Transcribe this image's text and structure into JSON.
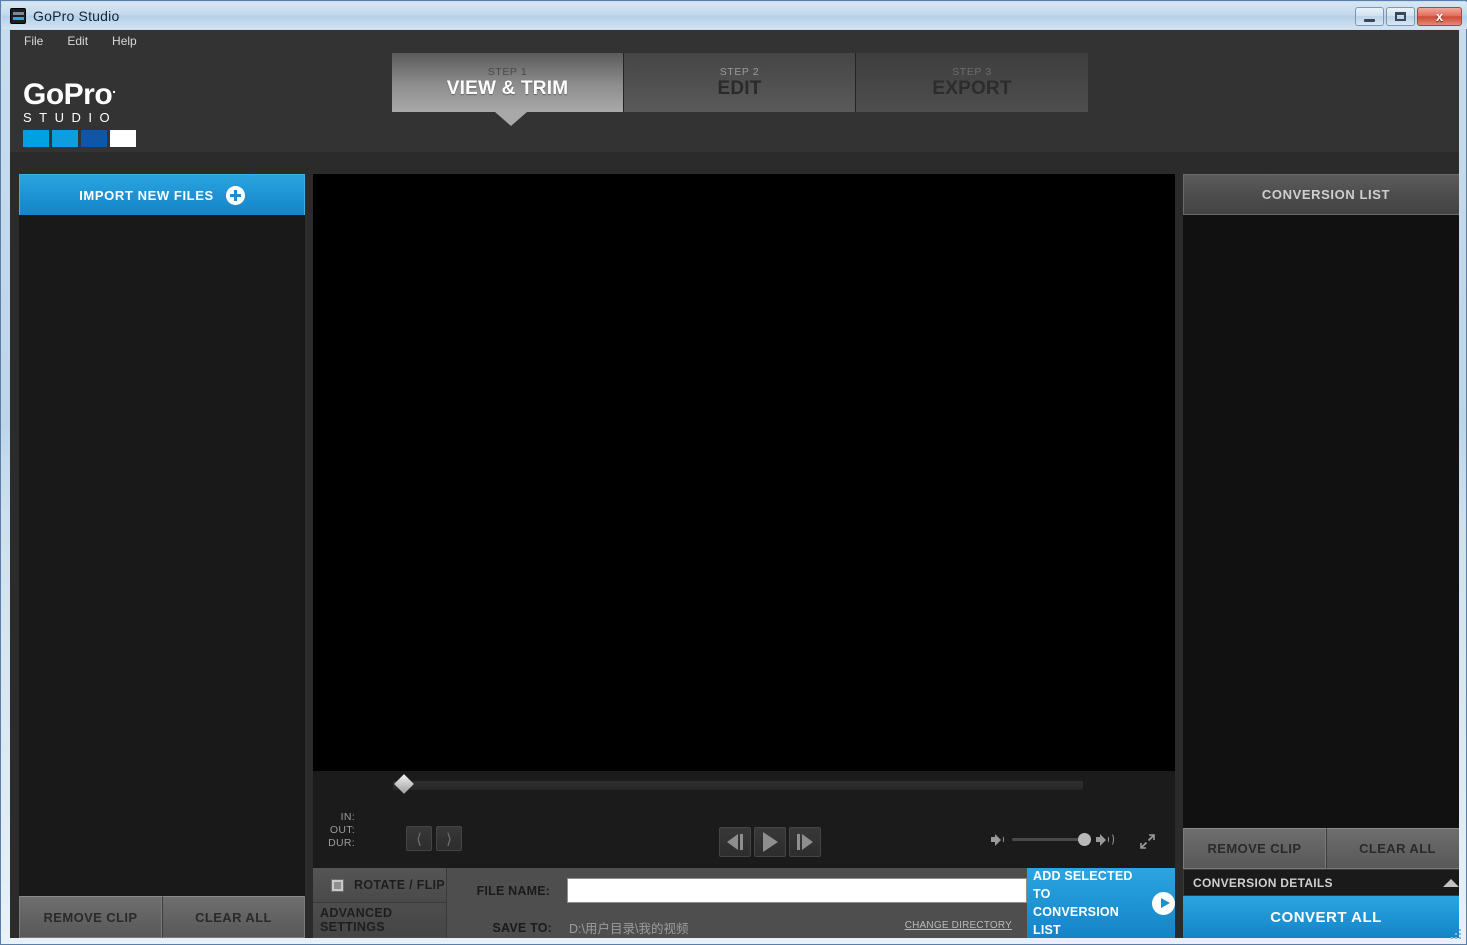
{
  "window": {
    "title": "GoPro Studio",
    "minimize_label": "Minimize",
    "maximize_label": "Maximize",
    "close_label": "x"
  },
  "menu": [
    {
      "label": "File"
    },
    {
      "label": "Edit"
    },
    {
      "label": "Help"
    }
  ],
  "logo": {
    "brand": "GoPro",
    "brand_mark": ".",
    "product": "STUDIO",
    "swatches": [
      "#00a1e0",
      "#0e9ee0",
      "#0d57a6",
      "#ffffff"
    ]
  },
  "steps": [
    {
      "num": "STEP 1",
      "name": "VIEW & TRIM",
      "active": true
    },
    {
      "num": "STEP 2",
      "name": "EDIT",
      "active": false
    },
    {
      "num": "STEP 3",
      "name": "EXPORT",
      "active": false
    }
  ],
  "left_panel": {
    "import_label": "IMPORT NEW FILES",
    "remove_clip_label": "REMOVE CLIP",
    "clear_all_label": "CLEAR ALL",
    "clips": []
  },
  "player": {
    "in_label": "IN:",
    "out_label": "OUT:",
    "dur_label": "DUR:",
    "in_value": "",
    "out_value": "",
    "dur_value": "",
    "set_in_label": "Set In Point",
    "set_out_label": "Set Out Point",
    "prev_frame_label": "Previous Frame",
    "play_label": "Play",
    "next_frame_label": "Next Frame",
    "volume_percent": 100,
    "fullscreen_label": "Fullscreen",
    "playhead_position_percent": 0
  },
  "settings": {
    "rotate_flip_label": "ROTATE / FLIP",
    "rotate_flip_checked": false,
    "advanced_settings_label": "ADVANCED SETTINGS",
    "file_name_label": "FILE NAME:",
    "file_name_value": "",
    "save_to_label": "SAVE TO:",
    "save_to_value": "D:\\用户目录\\我的视频",
    "change_directory_label": "CHANGE DIRECTORY",
    "add_selected_line1": "ADD SELECTED TO",
    "add_selected_line2": "CONVERSION LIST"
  },
  "right_panel": {
    "header": "CONVERSION LIST",
    "remove_clip_label": "REMOVE CLIP",
    "clear_all_label": "CLEAR ALL",
    "conversion_details_label": "CONVERSION DETAILS",
    "convert_all_label": "CONVERT ALL",
    "items": []
  },
  "colors": {
    "accent_blue": "#1e93d4",
    "panel_dark": "#1b1b1b",
    "chrome_gray": "#333333",
    "video_black": "#000000"
  }
}
